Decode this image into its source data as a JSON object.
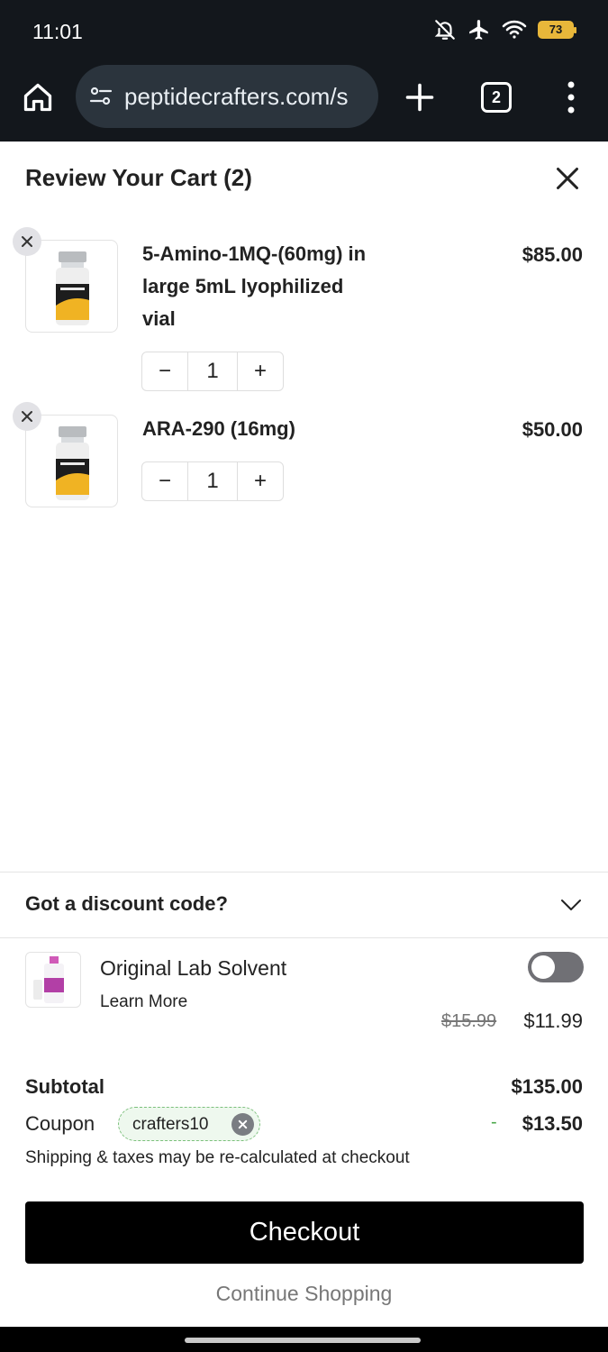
{
  "status_bar": {
    "time": "11:01",
    "battery": "73"
  },
  "browser": {
    "url": "peptidecrafters.com/s",
    "tab_count": "2"
  },
  "cart": {
    "title": "Review Your Cart (2)",
    "items": [
      {
        "name": "5-Amino-1MQ-(60mg) in large 5mL lyophilized vial",
        "price": "$85.00",
        "quantity": "1",
        "decrease": "−",
        "increase": "+"
      },
      {
        "name": "ARA-290 (16mg)",
        "price": "$50.00",
        "quantity": "1",
        "decrease": "−",
        "increase": "+"
      }
    ]
  },
  "discount": {
    "label": "Got a discount code?"
  },
  "upsell": {
    "name": "Original Lab Solvent",
    "learn_more": "Learn More",
    "old_price": "$15.99",
    "new_price": "$11.99",
    "enabled": false
  },
  "totals": {
    "subtotal_label": "Subtotal",
    "subtotal_value": "$135.00",
    "coupon_label": "Coupon",
    "coupon_code": "crafters10",
    "coupon_sign": "-",
    "coupon_value": "$13.50",
    "shipping_note": "Shipping & taxes may be re-calculated at checkout"
  },
  "actions": {
    "checkout": "Checkout",
    "continue_shopping": "Continue Shopping"
  },
  "icons": {
    "home": "home-icon",
    "site_settings": "tune-icon",
    "new_tab": "plus-icon",
    "menu": "more-vert-icon",
    "close": "close-icon",
    "chevron": "chevron-down-icon"
  }
}
